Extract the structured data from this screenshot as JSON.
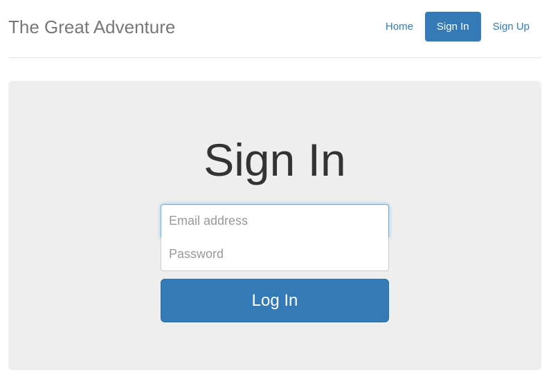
{
  "header": {
    "brand": "The Great Adventure",
    "nav": [
      {
        "label": "Home",
        "active": false
      },
      {
        "label": "Sign In",
        "active": true
      },
      {
        "label": "Sign Up",
        "active": false
      }
    ]
  },
  "main": {
    "title": "Sign In",
    "email": {
      "value": "",
      "placeholder": "Email address",
      "focused": true
    },
    "password": {
      "value": "",
      "placeholder": "Password"
    },
    "submit_label": "Log In"
  },
  "colors": {
    "primary": "#337ab7",
    "jumbotron_bg": "#eeeeee",
    "brand_text": "#777777",
    "heading_text": "#333333",
    "focus_border": "#66afe9"
  }
}
